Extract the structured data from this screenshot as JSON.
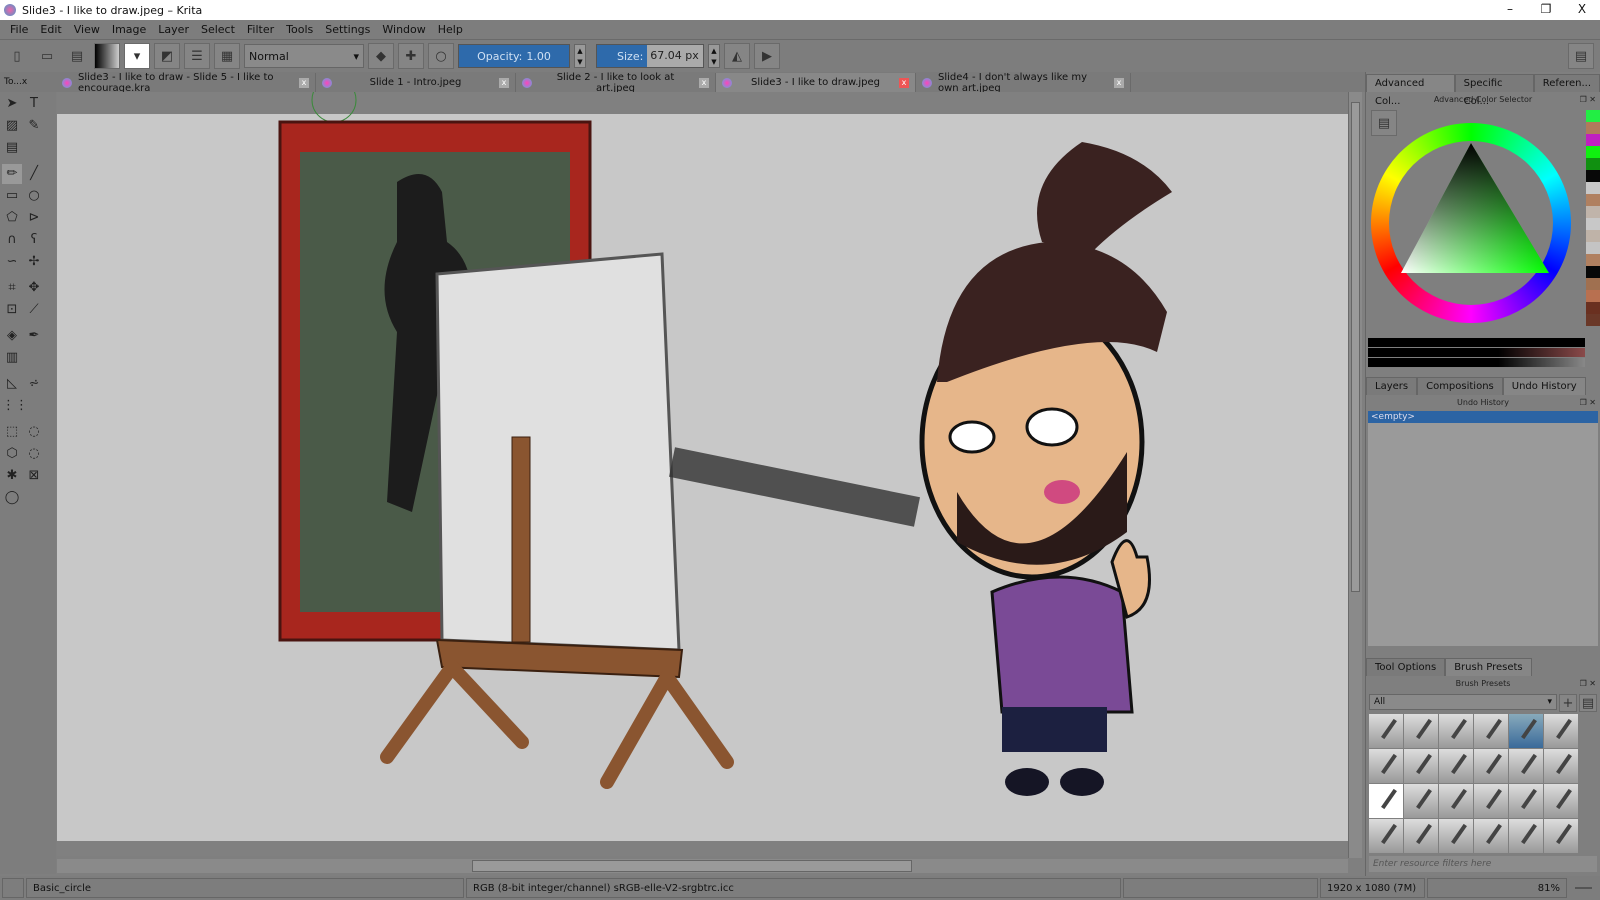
{
  "window": {
    "title": "Slide3 - I like to draw.jpeg – Krita",
    "minimize": "–",
    "maximize": "❐",
    "close": "X"
  },
  "menu": [
    "File",
    "Edit",
    "View",
    "Image",
    "Layer",
    "Select",
    "Filter",
    "Tools",
    "Settings",
    "Window",
    "Help"
  ],
  "toolbar": {
    "blend_mode": "Normal",
    "opacity_label": "Opacity:",
    "opacity_value": "1.00",
    "size_label": "Size:",
    "size_value": "67.04 px"
  },
  "toolbox_title": "To...x",
  "tabs": [
    {
      "label": "Slide3 - I like to draw - Slide 5 - I like to encourage.kra",
      "active": false
    },
    {
      "label": "Slide 1 - Intro.jpeg",
      "active": false
    },
    {
      "label": "Slide 2 - I like to look at art.jpeg",
      "active": false
    },
    {
      "label": "Slide3 - I like to draw.jpeg",
      "active": true
    },
    {
      "label": "Slide4 - I don't always like my own art.jpeg",
      "active": false
    }
  ],
  "color_panel": {
    "tabs": [
      "Advanced Col...",
      "Specific Col...",
      "Referen..."
    ],
    "title": "Advanced Color Selector",
    "selected_hue": "#00ff40",
    "history_swatches": [
      "#22ee44",
      "#b07a5c",
      "#c020c0",
      "#10f010",
      "#109010",
      "#080808",
      "#c8c8c8",
      "#b08060",
      "#c0b4aa",
      "#c8c8c8",
      "#bfb3a8",
      "#c4c4c4",
      "#b08060",
      "#080808",
      "#a07050",
      "#b87050",
      "#6a3020",
      "#6a3828"
    ]
  },
  "layers_panel": {
    "tabs": [
      "Layers",
      "Compositions",
      "Undo History"
    ],
    "title": "Undo History",
    "items": [
      "<empty>"
    ]
  },
  "brush_panel": {
    "tabs": [
      "Tool Options",
      "Brush Presets"
    ],
    "title": "Brush Presets",
    "filter_value": "All",
    "search_placeholder": "Enter resource filters here",
    "selected_index": 4,
    "count": 24
  },
  "status": {
    "brush": "Basic_circle",
    "color_space": "RGB (8-bit integer/channel)  sRGB-elle-V2-srgbtrc.icc",
    "dimensions": "1920 x 1080 (7M)",
    "zoom": "81%"
  }
}
